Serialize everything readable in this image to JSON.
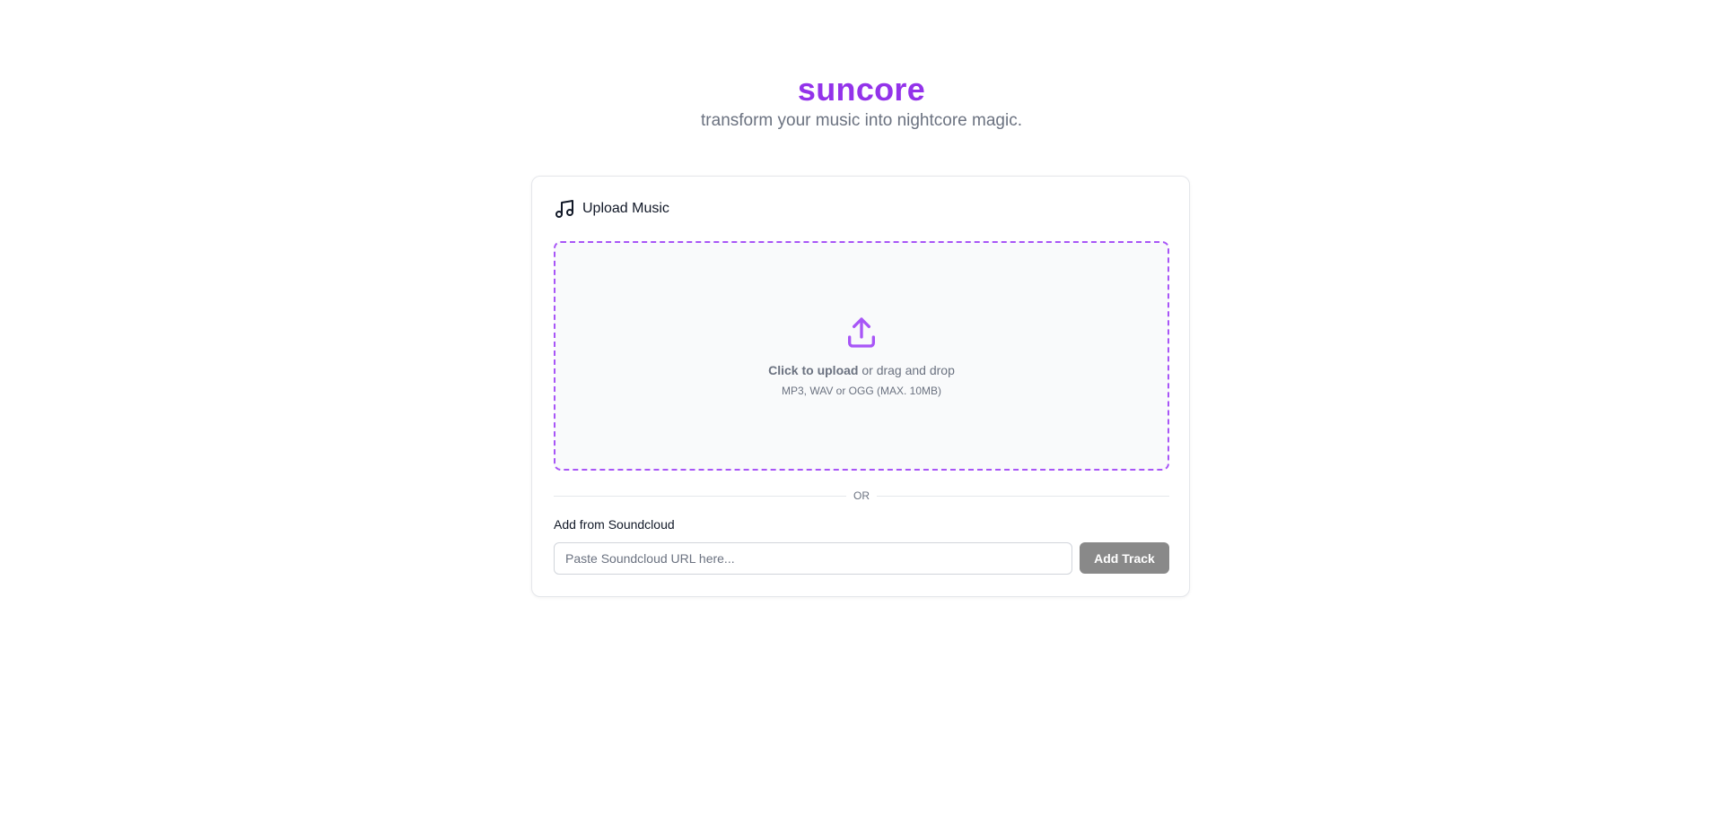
{
  "header": {
    "title": "suncore",
    "subtitle": "transform your music into nightcore magic."
  },
  "upload_card": {
    "title": "Upload Music",
    "title_icon": "music-note-icon",
    "dropzone": {
      "icon": "upload-icon",
      "click_text": "Click to upload",
      "drag_text": " or drag and drop",
      "hint": "MP3, WAV or OGG (MAX. 10MB)"
    },
    "divider_text": "OR",
    "soundcloud": {
      "label": "Add from Soundcloud",
      "placeholder": "Paste Soundcloud URL here...",
      "value": "",
      "button_label": "Add Track"
    }
  },
  "colors": {
    "accent": "#9333ea",
    "dropzone_border": "#a855f7",
    "button_disabled": "#898989"
  }
}
